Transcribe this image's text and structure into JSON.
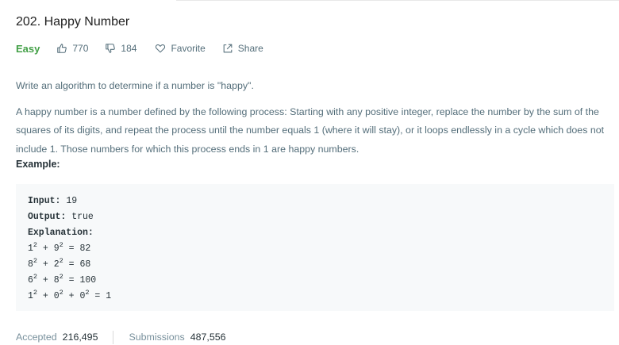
{
  "problem": {
    "title": "202. Happy Number",
    "difficulty": "Easy",
    "likes": "770",
    "dislikes": "184",
    "favorite_label": "Favorite",
    "share_label": "Share"
  },
  "description": {
    "paragraph_1": "Write an algorithm to determine if a number is \"happy\".",
    "paragraph_2": "A happy number is a number defined by the following process: Starting with any positive integer, replace the number by the sum of the squares of its digits, and repeat the process until the number equals 1 (where it will stay), or it loops endlessly in a cycle which does not include 1. Those numbers for which this process ends in 1 are happy numbers."
  },
  "example": {
    "heading": "Example:",
    "input_label": "Input:",
    "input_value": "19",
    "output_label": "Output:",
    "output_value": "true",
    "explanation_label": "Explanation:",
    "steps": [
      {
        "a": "1",
        "b": "9",
        "result": "82"
      },
      {
        "a": "8",
        "b": "2",
        "result": "68"
      },
      {
        "a": "6",
        "b": "8",
        "result": "100"
      },
      {
        "a": "1",
        "b": "0",
        "c": "0",
        "result": "1"
      }
    ],
    "exponent": "2",
    "plus": "+",
    "equals": "="
  },
  "stats": {
    "accepted_label": "Accepted",
    "accepted_value": "216,495",
    "submissions_label": "Submissions",
    "submissions_value": "487,556"
  },
  "colors": {
    "difficulty_easy": "#43a047",
    "code_background": "#f7f9fa",
    "text_muted": "#546e7a"
  },
  "icons": {
    "like": "thumbs-up-icon",
    "dislike": "thumbs-down-icon",
    "favorite": "heart-icon",
    "share": "share-icon"
  }
}
